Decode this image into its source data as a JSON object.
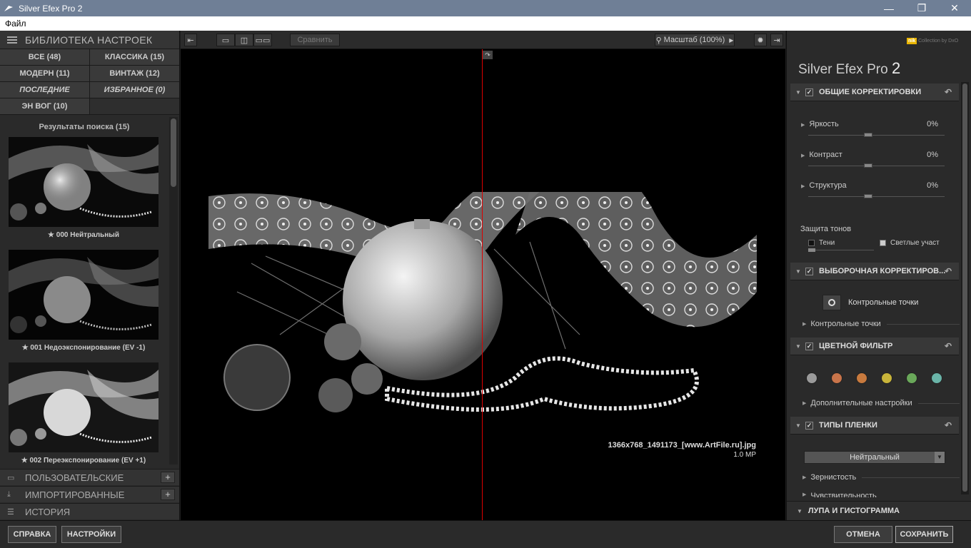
{
  "window": {
    "title": "Silver Efex Pro 2",
    "minimize": "—",
    "maximize": "❐",
    "close": "✕"
  },
  "menu": {
    "file": "Файл"
  },
  "library": {
    "header": "БИБЛИОТЕКА НАСТРОЕК",
    "categories": [
      "ВСЕ (48)",
      "КЛАССИКА (15)",
      "МОДЕРН (11)",
      "ВИНТАЖ (12)",
      "ПОСЛЕДНИЕ",
      "ИЗБРАННОЕ (0)",
      "ЭН ВОГ (10)"
    ],
    "results_title": "Результаты поиска (15)",
    "presets": [
      {
        "label": "★ 000 Нейтральный"
      },
      {
        "label": "★ 001 Недоэкспонирование (EV -1)"
      },
      {
        "label": "★ 002 Переэкспонирование  (EV +1)"
      }
    ],
    "sections": {
      "custom": "ПОЛЬЗОВАТЕЛЬСКИЕ",
      "imported": "ИМПОРТИРОВАННЫЕ",
      "history": "ИСТОРИЯ",
      "plus": "+"
    }
  },
  "toolbar": {
    "compare": "Сравнить",
    "zoom": "Масштаб (100%)"
  },
  "canvas": {
    "filename": "1366x768_1491173_[www.ArtFile.ru].jpg",
    "megapixels": "1.0 MP"
  },
  "right": {
    "brand_logo": "Collection by DxO",
    "brand_name": "Silver Efex Pro",
    "brand_ver": "2",
    "global": {
      "title": "ОБЩИЕ КОРРЕКТИРОВКИ",
      "sliders": [
        {
          "label": "Яркость",
          "value": "0%"
        },
        {
          "label": "Контраст",
          "value": "0%"
        },
        {
          "label": "Структура",
          "value": "0%"
        }
      ],
      "tone_protection": "Защита тонов",
      "shadows": "Тени",
      "highlights": "Светлые участ"
    },
    "selective": {
      "title": "ВЫБОРОЧНАЯ КОРРЕКТИРОВ...",
      "control_points_btn": "Контрольные точки",
      "control_points": "Контрольные точки"
    },
    "color_filter": {
      "title": "ЦВЕТНОЙ ФИЛЬТР",
      "colors": [
        "#9a9a9a",
        "#c8744a",
        "#c87a3e",
        "#c8b43a",
        "#6aa85a",
        "#6ab4a8"
      ],
      "advanced": "Дополнительные настройки"
    },
    "film": {
      "title": "ТИПЫ ПЛЕНКИ",
      "selected": "Нейтральный",
      "grain": "Зернистость",
      "sensitivity": "Чувствительность"
    },
    "loupe": "ЛУПА И ГИСТОГРАММА"
  },
  "bottom": {
    "help": "СПРАВКА",
    "settings": "НАСТРОЙКИ",
    "cancel": "ОТМЕНА",
    "save": "СОХРАНИТЬ"
  }
}
